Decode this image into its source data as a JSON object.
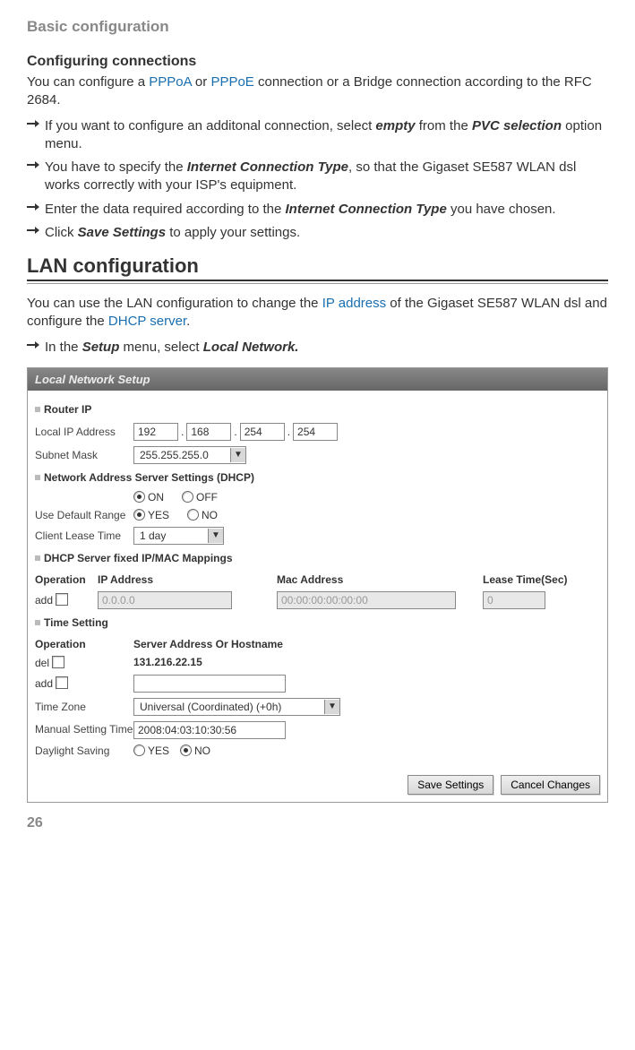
{
  "header": "Basic configuration",
  "configuring_title": "Configuring connections",
  "intro_1a": "You can configure a ",
  "intro_1_link1": "PPPoA",
  "intro_1b": " or ",
  "intro_1_link2": "PPPoE",
  "intro_1c": " connection or a Bridge connection according to the RFC 2684.",
  "bullets": [
    {
      "pre": "If you want to configure an additonal connection, select ",
      "b1": "empty",
      "mid": " from the ",
      "b2": "PVC selection",
      "post": " option menu."
    },
    {
      "pre": "You have to specify the ",
      "b1": "Internet Connection Type",
      "mid": ", so that the Gigaset SE587 WLAN dsl works correctly with your ISP's equipment.",
      "b2": "",
      "post": ""
    },
    {
      "pre": "Enter the data required according to the ",
      "b1": "Internet Connection Type",
      "mid": " you have chosen.",
      "b2": "",
      "post": ""
    },
    {
      "pre": "Click ",
      "b1": "Save Settings",
      "mid": " to apply your settings.",
      "b2": "",
      "post": ""
    }
  ],
  "lan_heading": "LAN configuration",
  "lan_text_a": "You can use the LAN configuration to change the ",
  "lan_link1": "IP address",
  "lan_text_b": " of the Gigaset SE587 WLAN dsl and configure the ",
  "lan_link2": "DHCP server",
  "lan_text_c": ".",
  "lan_bullet_pre": "In the ",
  "lan_bullet_b1": "Setup",
  "lan_bullet_mid": " menu, select ",
  "lan_bullet_b2": "Local Network.",
  "shot": {
    "title": "Local Network Setup",
    "router_ip": "Router IP",
    "local_ip_lbl": "Local IP Address",
    "ip": [
      "192",
      "168",
      "254",
      "254"
    ],
    "subnet_lbl": "Subnet Mask",
    "subnet_val": "255.255.255.0",
    "dhcp_hdr": "Network Address Server Settings (DHCP)",
    "on": "ON",
    "off": "OFF",
    "default_range_lbl": "Use Default Range",
    "yes": "YES",
    "no": "NO",
    "lease_lbl": "Client Lease Time",
    "lease_val": "1 day",
    "fixed_hdr": "DHCP Server fixed IP/MAC Mappings",
    "col_op": "Operation",
    "col_ip": "IP Address",
    "col_mac": "Mac Address",
    "col_lease": "Lease Time(Sec)",
    "add": "add",
    "del": "del",
    "ip_placeholder": "0.0.0.0",
    "mac_placeholder": "00:00:00:00:00:00",
    "lease_placeholder": "0",
    "time_hdr": "Time Setting",
    "time_col_op": "Operation",
    "time_col_val": "Server Address Or Hostname",
    "server_ip": "131.216.22.15",
    "tz_lbl": "Time Zone",
    "tz_val": "Universal (Coordinated) (+0h)",
    "manual_lbl": "Manual Setting Time",
    "manual_val": "2008:04:03:10:30:56",
    "daylight_lbl": "Daylight Saving",
    "save_btn": "Save Settings",
    "cancel_btn": "Cancel Changes"
  },
  "page_num": "26"
}
